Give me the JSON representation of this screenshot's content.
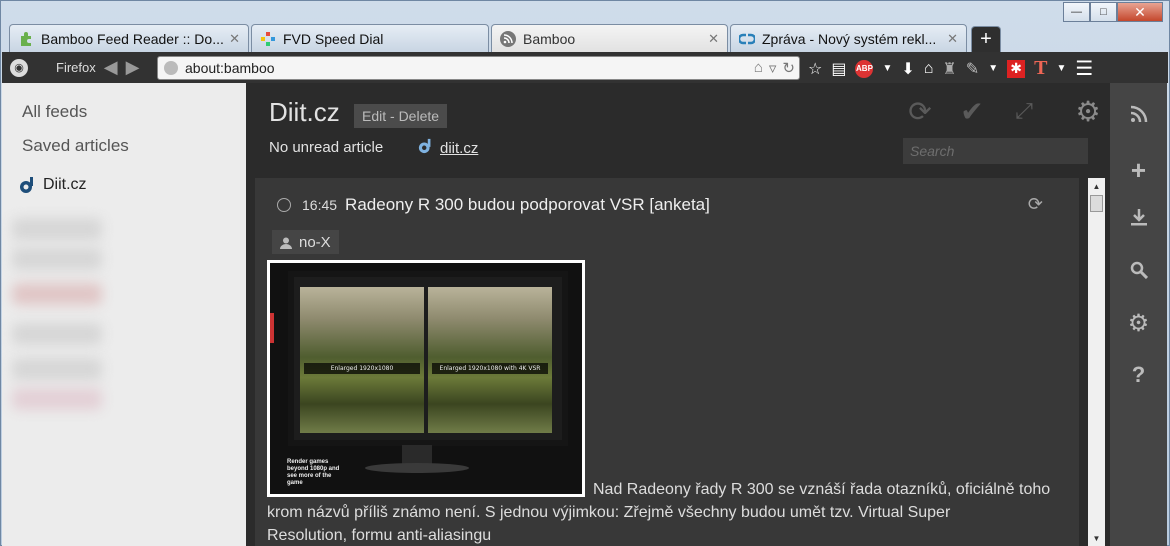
{
  "window": {
    "minimize_glyph": "—",
    "maximize_glyph": "□",
    "close_glyph": "✕"
  },
  "tabs": [
    {
      "label": "Bamboo Feed Reader :: Do...",
      "icon": "puzzle-icon",
      "active": false
    },
    {
      "label": "FVD Speed Dial",
      "icon": "speed-dial-icon",
      "active": false
    },
    {
      "label": "Bamboo",
      "icon": "rss-icon",
      "active": true
    },
    {
      "label": "Zpráva - Nový systém rekl...",
      "icon": "link-icon",
      "active": false
    }
  ],
  "tab_close_glyph": "✕",
  "new_tab_glyph": "+",
  "navbar": {
    "firefox_label": "Firefox",
    "url": "about:bamboo"
  },
  "left_sidebar": {
    "all_feeds": "All feeds",
    "saved_articles": "Saved articles",
    "feed_name": "Diit.cz"
  },
  "main": {
    "feed_title": "Diit.cz",
    "edit_delete": "Edit - Delete",
    "unread_status": "No unread article",
    "feed_link": "diit.cz",
    "search_placeholder": "Search"
  },
  "article": {
    "time": "16:45",
    "title": "Radeony R 300 budou podporovat VSR [anketa]",
    "author": "no-X",
    "image_label_left": "Enlarged 1920x1080",
    "image_label_right": "Enlarged 1920x1080 with 4K VSR",
    "image_caption": "Render games beyond 1080p and see more of the game",
    "text_line_1": "Nad Radeony řady R 300 se vznáší řada otazníků, oficiálně toho",
    "text_line_2": "krom názvů příliš známo není. S jednou výjimkou: Zřejmě všechny budou umět tzv. Virtual Super",
    "text_line_3": "Resolution, formu anti-aliasingu"
  },
  "colors": {
    "main_bg": "#2b2b2b",
    "article_bg": "#383838",
    "sidebar_bg": "#ececec",
    "right_sidebar_bg": "#454545"
  }
}
